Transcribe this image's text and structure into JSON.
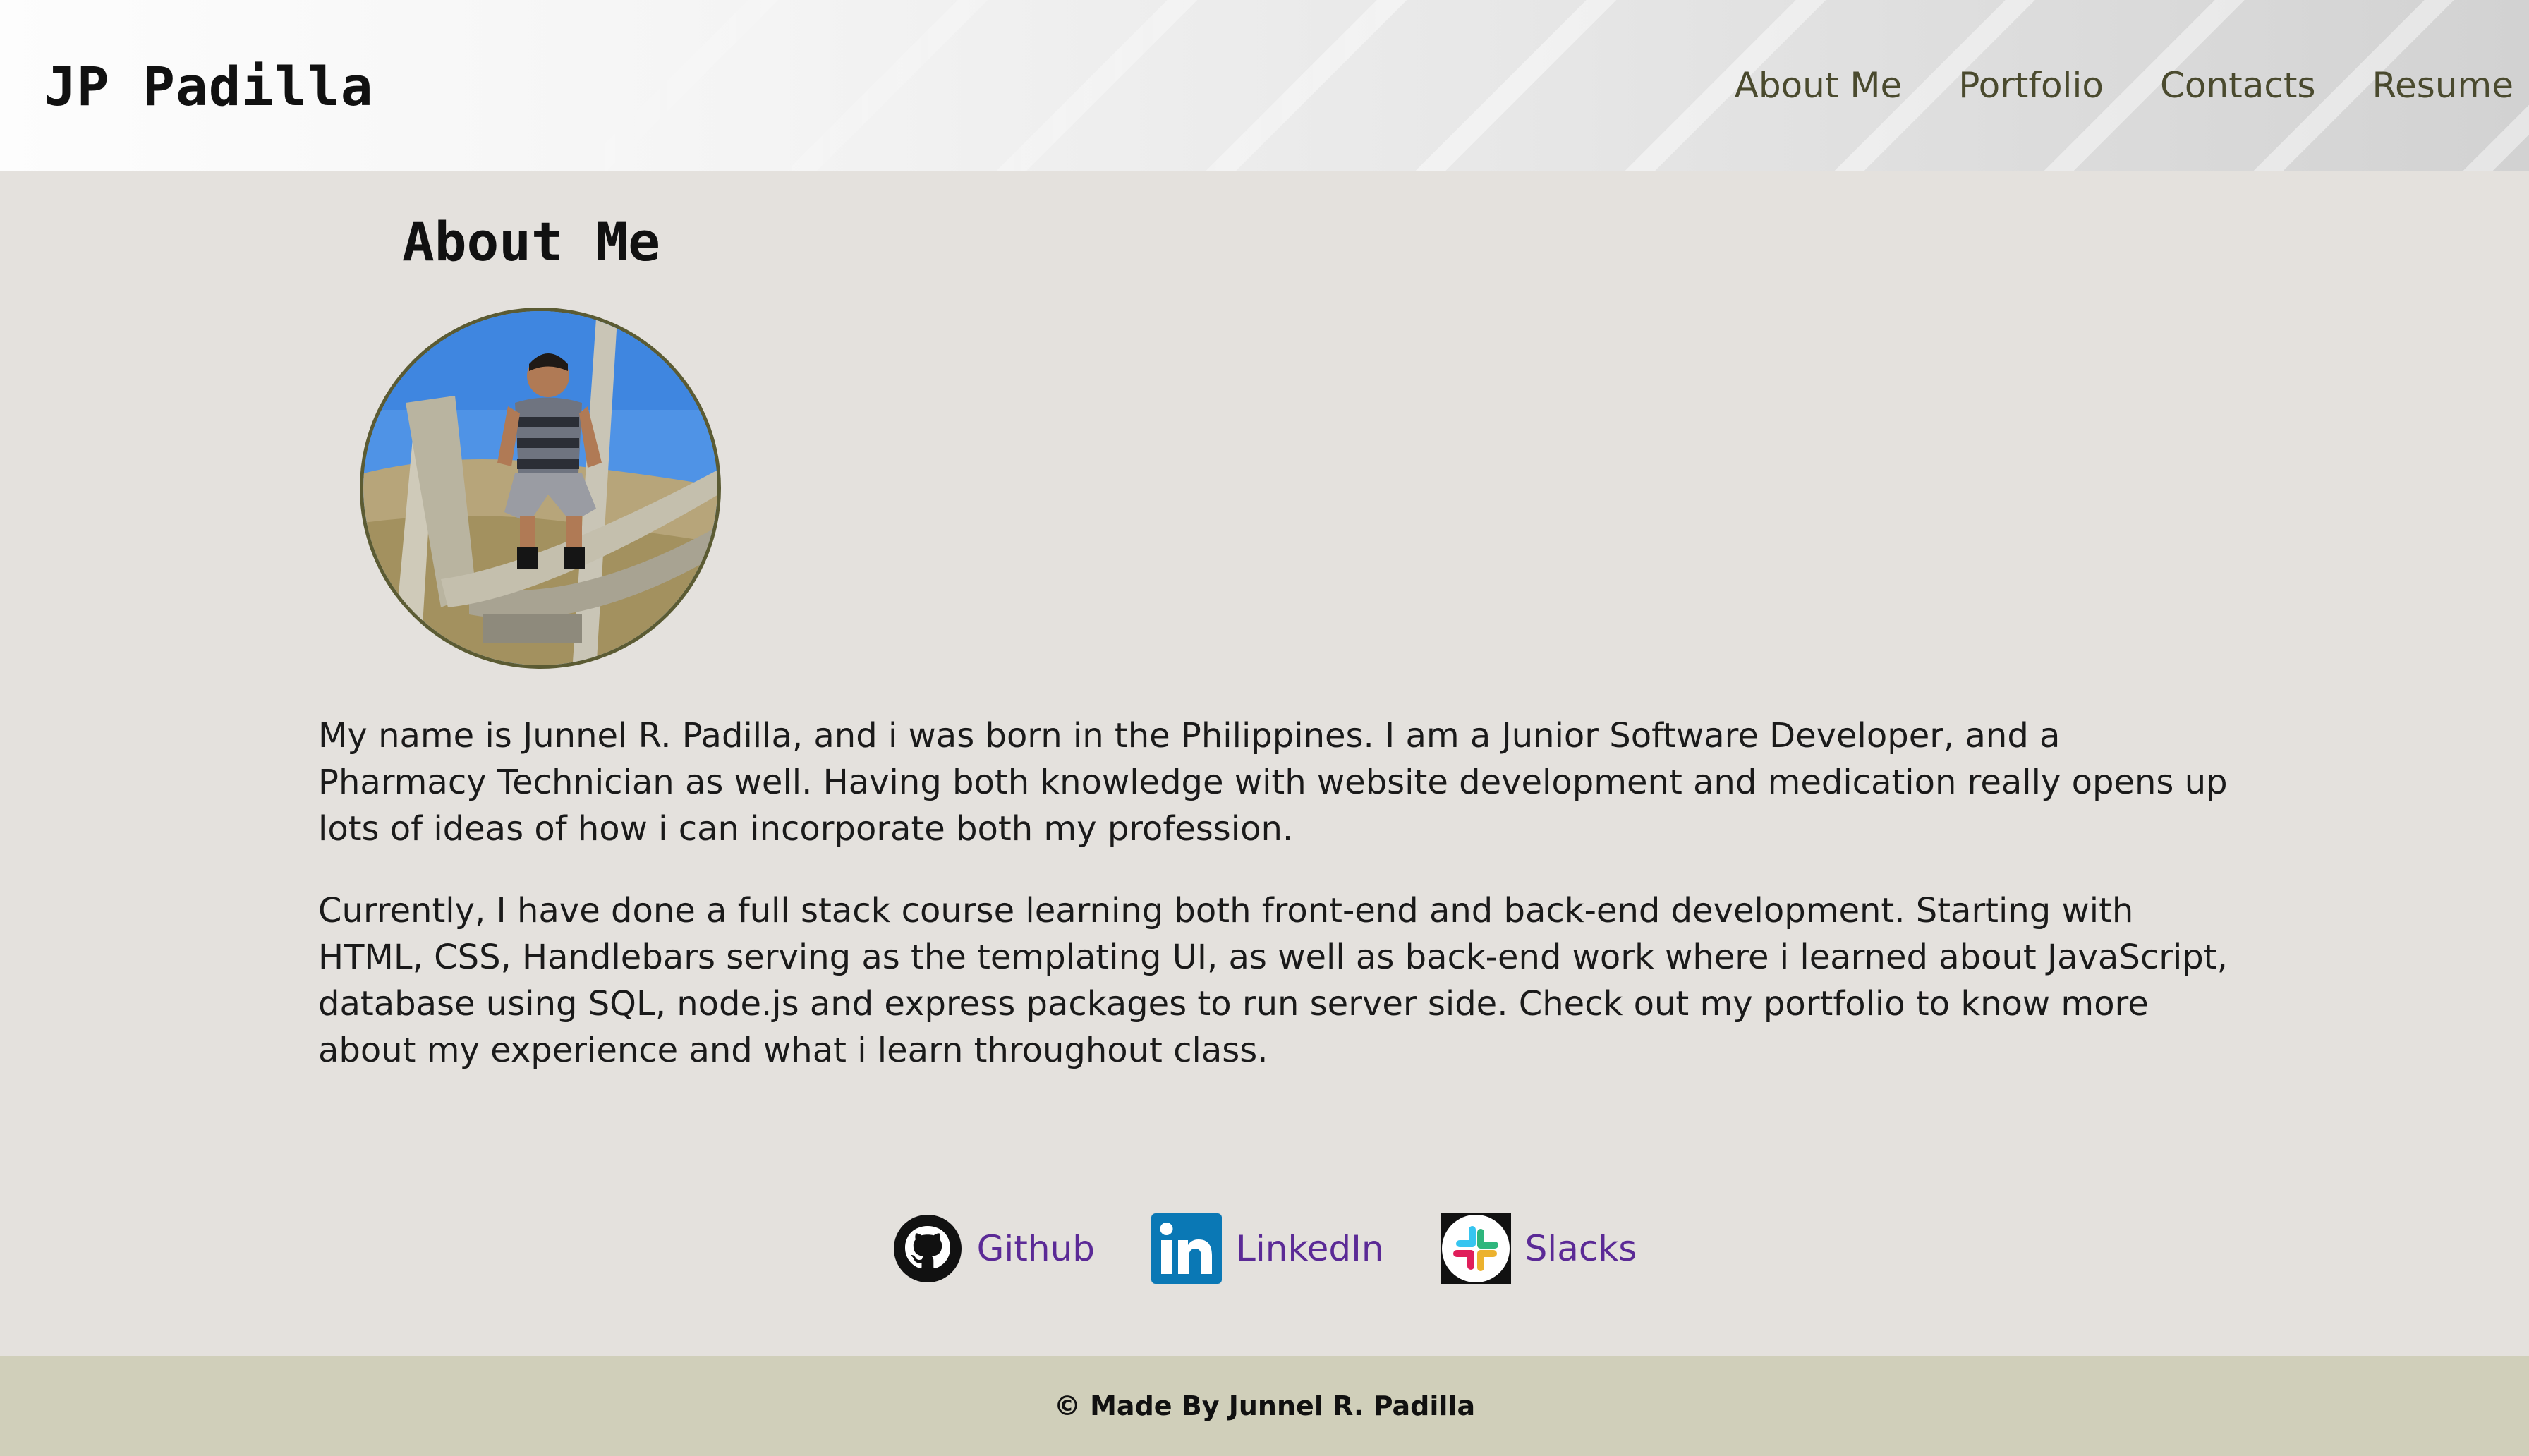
{
  "header": {
    "brand": "JP Padilla",
    "nav": [
      {
        "label": "About Me"
      },
      {
        "label": "Portfolio"
      },
      {
        "label": "Contacts"
      },
      {
        "label": "Resume"
      }
    ]
  },
  "main": {
    "title": "About Me",
    "paragraphs": [
      "My name is Junnel R. Padilla, and i was born in the Philippines. I am a Junior Software Developer, and a Pharmacy Technician as well. Having both knowledge with website development and medication really opens up lots of ideas of how i can incorporate both my profession.",
      "Currently, I have done a full stack course learning both front-end and back-end development. Starting with HTML, CSS, Handlebars serving as the templating UI, as well as back-end work where i learned about JavaScript, database using SQL, node.js and express packages to run server side. Check out my portfolio to know more about my experience and what i learn throughout class."
    ]
  },
  "socials": [
    {
      "label": "Github",
      "icon": "github-icon"
    },
    {
      "label": "LinkedIn",
      "icon": "linkedin-icon"
    },
    {
      "label": "Slacks",
      "icon": "slack-icon"
    }
  ],
  "footer": {
    "text": "© Made By Junnel R. Padilla"
  },
  "colors": {
    "page_bg": "#e4e1dd",
    "footer_bg": "#d0cfba",
    "nav_text": "#4a4a2e",
    "link_text": "#5b2a96",
    "avatar_border": "#5b5b33"
  }
}
